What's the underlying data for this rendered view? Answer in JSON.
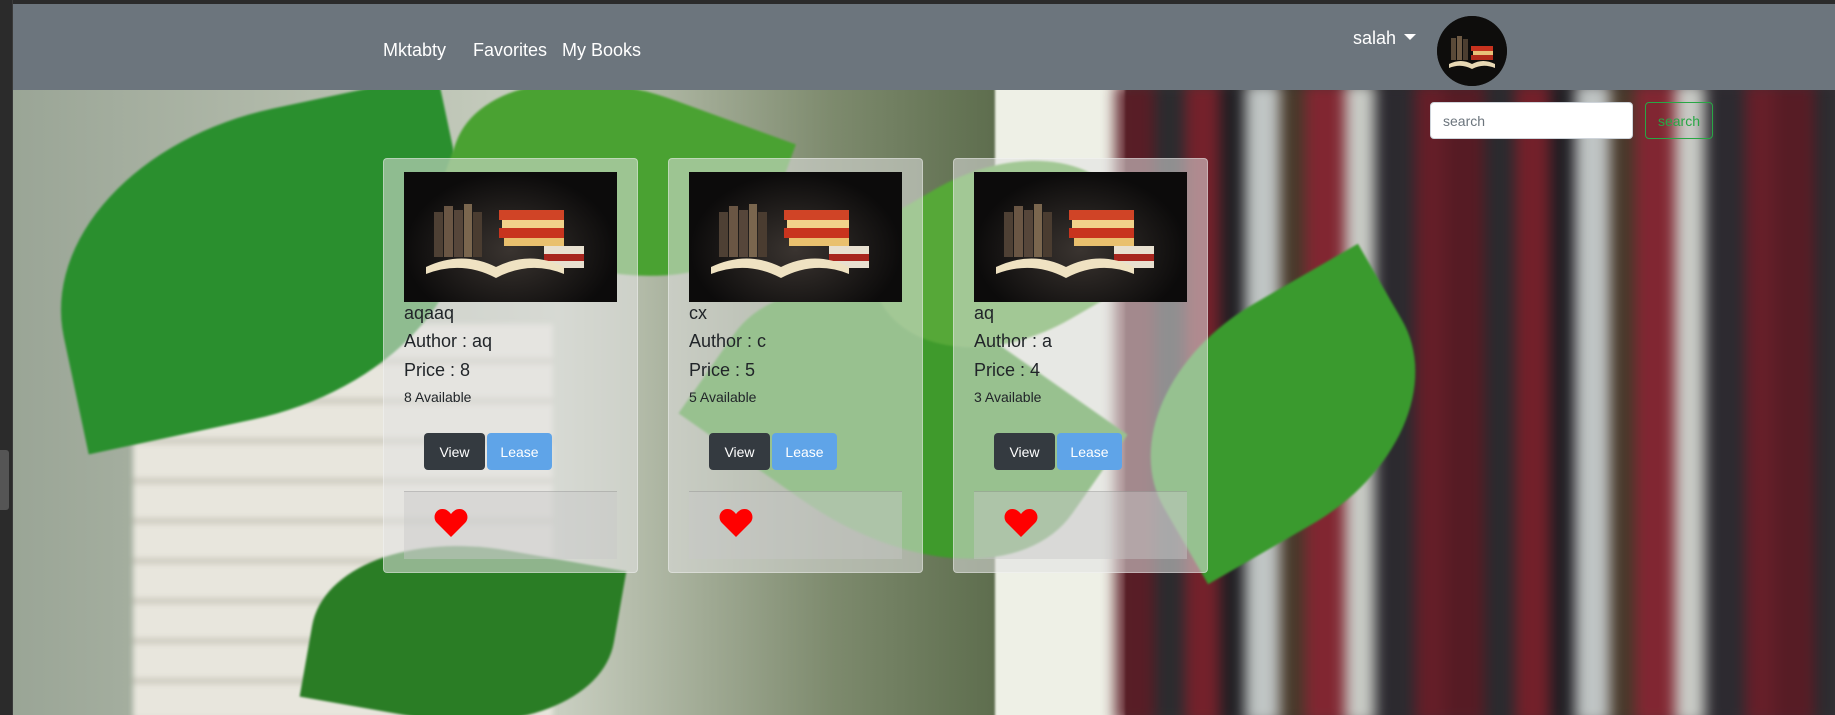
{
  "navbar": {
    "brand": "Mktabty",
    "links": [
      "Favorites",
      "My Books"
    ],
    "user_name": "salah"
  },
  "search": {
    "placeholder": "search",
    "button_label": "search"
  },
  "books": [
    {
      "title": "aqaaq",
      "author": "Author : aq",
      "price": "Price : 8",
      "available": "8 Available"
    },
    {
      "title": "cx",
      "author": "Author : c",
      "price": "Price : 5",
      "available": "5 Available"
    },
    {
      "title": "aq",
      "author": "Author : a",
      "price": "Price : 4",
      "available": "3 Available"
    }
  ],
  "card_actions": {
    "view_label": "View",
    "lease_label": "Lease"
  },
  "colors": {
    "navbar": "#6c757d",
    "view_button": "#343a40",
    "lease_button": "#5fa4e8",
    "search_button": "#28a745",
    "heart": "#ff0000"
  },
  "icons": {
    "favorite": "heart-icon",
    "dropdown": "caret-down-icon"
  }
}
